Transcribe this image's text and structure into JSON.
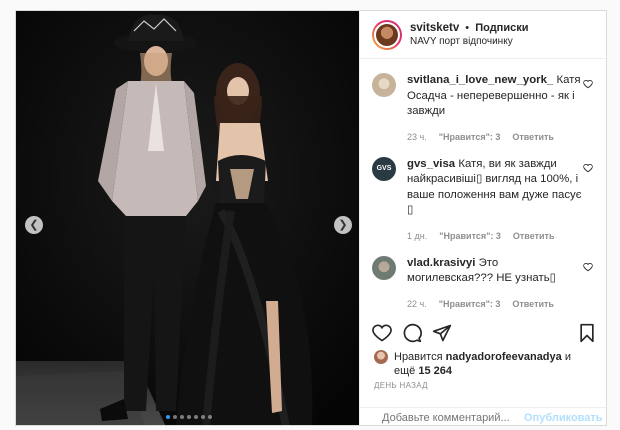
{
  "header": {
    "username": "svitsketv",
    "separator": "•",
    "follow_label": "Подписки",
    "location": "NAVY порт відпочинку"
  },
  "comments": [
    {
      "username": "svitlana_i_love_new_york_",
      "text": "Катя Осадча - неперевершенно - як і завжди",
      "time": "23 ч.",
      "likes": "\"Нравится\": 3",
      "reply": "Ответить",
      "avatar_color": "#c7b39a"
    },
    {
      "username": "gvs_visa",
      "text": "Катя, ви як завжди найкрасивіші▯ вигляд на 100%, і ваше положення вам дуже пасує ▯",
      "time": "1 дн.",
      "likes": "\"Нравится\": 3",
      "reply": "Ответить",
      "avatar_label": "GVS",
      "avatar_color": "#2a3a42"
    },
    {
      "username": "vlad.krasivyi",
      "text": "Это могилевская??? НЕ узнать▯",
      "time": "22 ч.",
      "likes": "\"Нравится\": 3",
      "reply": "Ответить",
      "avatar_color": "#6f7a73"
    }
  ],
  "likes": {
    "prefix": "Нравится",
    "user": "nadyadorofeevanadya",
    "suffix_and": "и",
    "more_prefix": "ещё",
    "more_count": "15 264"
  },
  "date": "ДЕНЬ НАЗАД",
  "add_comment": {
    "placeholder": "Добавьте комментарий...",
    "publish_label": "Опубликовать"
  },
  "carousel": {
    "dots": 7,
    "active_index": 0
  },
  "colors": {
    "link": "#3897f0",
    "publish_disabled": "#b2dffc",
    "meta": "#8e8e8e"
  }
}
